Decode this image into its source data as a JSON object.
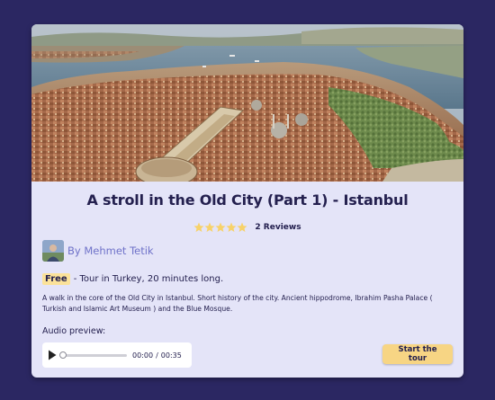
{
  "tour": {
    "title": "A stroll in the Old City (Part 1) - Istanbul",
    "rating": 5,
    "reviews": "2 Reviews",
    "author": "By Mehmet Tetik",
    "badge": "Free",
    "meta": "- Tour in Turkey, 20 minutes long.",
    "description": "A walk in the core of the Old City in Istanbul. Short history of the city. Ancient hippodrome, Ibrahim Pasha Palace ( Turkish and Islamic Art Museum ) and the Blue Mosque."
  },
  "audio": {
    "label": "Audio preview:",
    "current_time": "00:00",
    "separator": "/",
    "duration": "00:35",
    "progress": 0
  },
  "actions": {
    "start_label": "Start the tour"
  },
  "colors": {
    "page_bg": "#2b2762",
    "card_bg": "#e4e4f8",
    "star": "#f7d26a",
    "accent_button": "#f7d584",
    "author_link": "#6f72c9"
  },
  "icons": {
    "play": "play-icon",
    "star": "star-icon"
  }
}
